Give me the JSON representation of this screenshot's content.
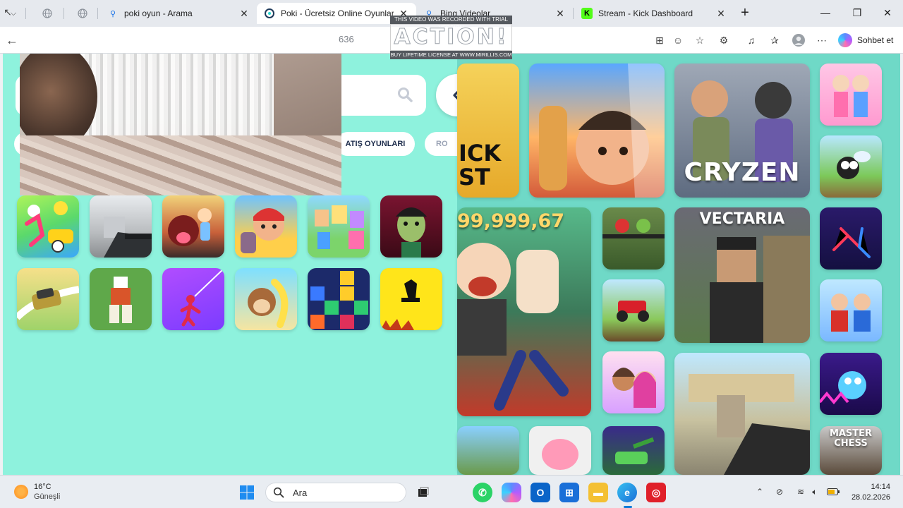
{
  "browser": {
    "tabs": [
      {
        "title": "",
        "icon": "globe-icon"
      },
      {
        "title": "",
        "icon": "globe-icon"
      },
      {
        "title": "poki oyun - Arama",
        "icon": "search-icon"
      },
      {
        "title": "Poki - Ücretsiz Online Oyunlar - H",
        "icon": "poki-icon"
      },
      {
        "title": "Bing Videolar",
        "icon": "search-icon"
      },
      {
        "title": "Stream - Kick Dashboard",
        "icon": "kick-icon"
      }
    ],
    "url_fragment": "636",
    "sohbet_label": "Sohbet et",
    "accent": "#0e7ad8"
  },
  "watermark": {
    "top": "THIS VIDEO WAS RECORDED WITH TRIAL VERSION",
    "main": "ACTION!",
    "bottom": "BUY LIFETIME LICENSE AT WWW.MIRILLIS.COM"
  },
  "poki": {
    "categories": [
      "ATIŞ OYUNLARI",
      "RO"
    ],
    "right_tile_titles": {
      "kick": "ICK\nST",
      "cryzen": "CRYZEN",
      "counter": "99,999,67",
      "vectaria": "VECTARIA",
      "master": "MASTER\nCHESS"
    }
  },
  "taskbar": {
    "temperature": "16°C",
    "weather": "Güneşli",
    "search_placeholder": "Ara",
    "time": "14:14",
    "date": "28.02.2026"
  }
}
